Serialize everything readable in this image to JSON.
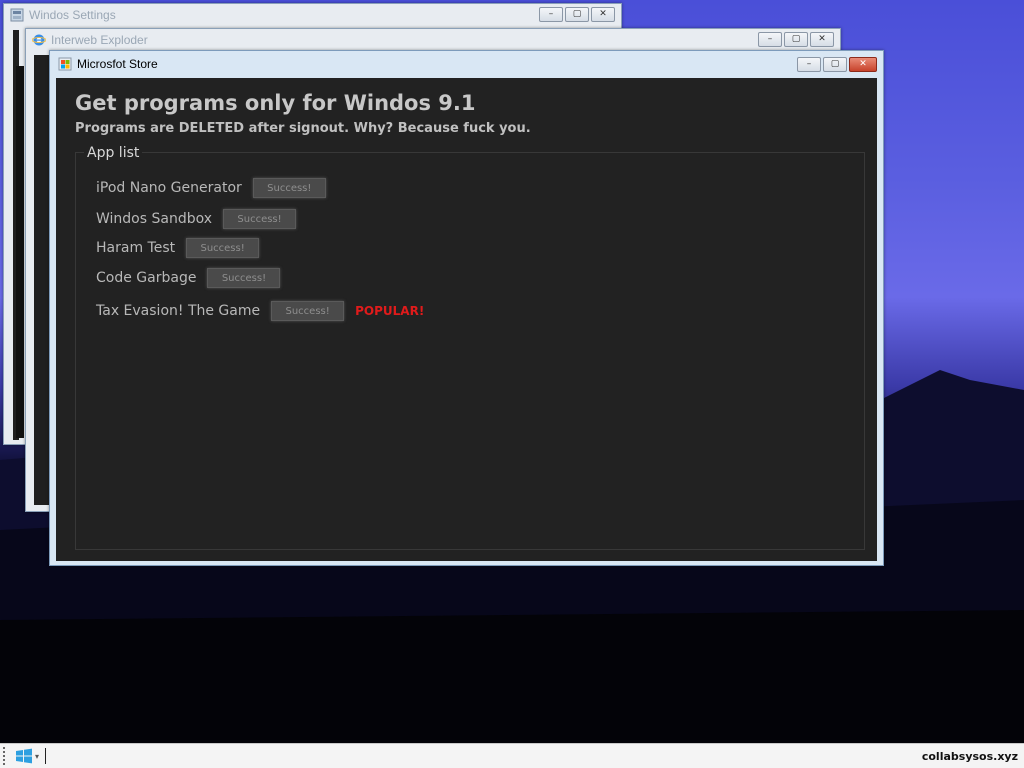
{
  "windows": {
    "settings": {
      "title": "Windos Settings"
    },
    "explorer": {
      "title": "Interweb Exploder"
    },
    "store": {
      "title": "Microsfot Store",
      "heading": "Get programs only for Windos 9.1",
      "subheading": "Programs are DELETED after signout. Why? Because fuck you.",
      "group_label": "App list",
      "apps": [
        {
          "name": "iPod Nano Generator",
          "button": "Success!"
        },
        {
          "name": "Windos Sandbox",
          "button": "Success!"
        },
        {
          "name": "Haram Test",
          "button": "Success!"
        },
        {
          "name": "Code Garbage",
          "button": "Success!"
        },
        {
          "name": "Tax Evasion! The Game",
          "button": "Success!",
          "badge": "POPULAR!"
        }
      ]
    }
  },
  "window_controls": {
    "minimize": "–",
    "maximize": "▢",
    "close": "✕"
  },
  "taskbar": {
    "site": "collabsysos.xyz"
  },
  "icons": {
    "start": "windows-logo-icon",
    "settings": "settings-app-icon",
    "explorer": "browser-e-icon",
    "store": "store-bag-icon"
  },
  "colors": {
    "store_body": "#222222",
    "popular": "#e01b1b",
    "accent_blue": "#2d9fe0"
  }
}
